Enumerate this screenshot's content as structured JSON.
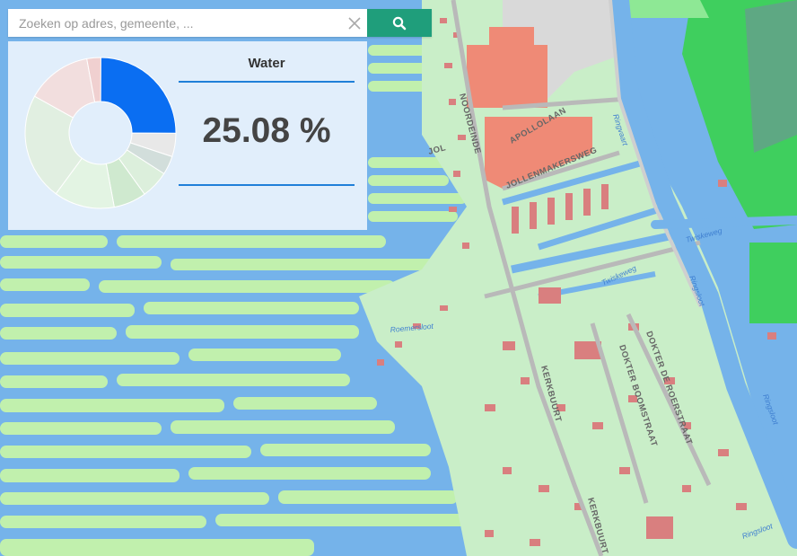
{
  "search": {
    "placeholder": "Zoeken op adres, gemeente, ...",
    "value": ""
  },
  "panel": {
    "title": "Water",
    "value": "25.08 %",
    "highlight_color": "#0a6ef2",
    "donut_fractions": [
      0.2508,
      0.05,
      0.04,
      0.06,
      0.07,
      0.13,
      0.23,
      0.14,
      0.03
    ]
  },
  "map": {
    "labels": {
      "noordeinde": "NOORDEINDE",
      "apollolaan": "APOLLOLAAN",
      "jol": "JOL",
      "jollenmakersweg": "JOLLENMAKERSWEG",
      "kerkbuurt": "KERKBUURT",
      "kerkbuurt2": "KERKBUURT",
      "dokter_boomstraat": "DOKTER BOOMSTRAAT",
      "dokter_de_roerstraat": "DOKTER DE ROERSTRAAT",
      "ringvaart": "Ringvaart",
      "ringsloot1": "Ringsloot",
      "ringsloot2": "Ringsloot",
      "ringsloot3": "Ringsloot",
      "twiskeweg1": "Twiskeweg",
      "twiskeweg2": "Twiskeweg",
      "roemersloot": "Roemersloot"
    }
  }
}
